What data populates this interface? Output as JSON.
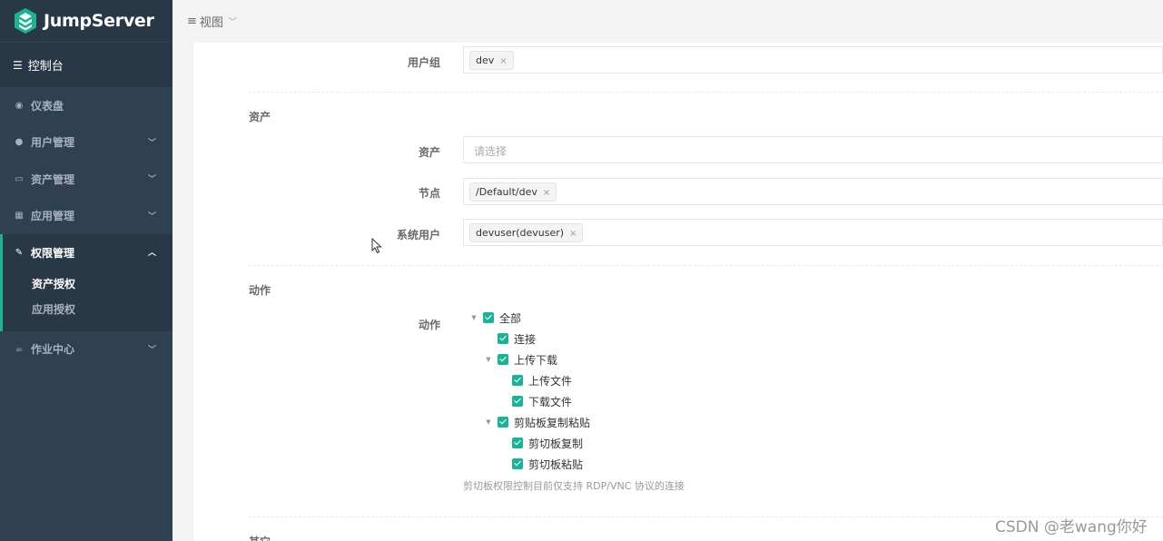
{
  "app": {
    "logo_text": "JumpServer"
  },
  "sidebar": {
    "console_label": "控制台",
    "items": [
      {
        "label": "仪表盘",
        "icon": "dashboard-icon",
        "expandable": false
      },
      {
        "label": "用户管理",
        "icon": "users-icon",
        "expandable": true
      },
      {
        "label": "资产管理",
        "icon": "inbox-icon",
        "expandable": true
      },
      {
        "label": "应用管理",
        "icon": "grid-icon",
        "expandable": true
      },
      {
        "label": "权限管理",
        "icon": "edit-icon",
        "expandable": true,
        "expanded": true
      },
      {
        "label": "作业中心",
        "icon": "coffee-icon",
        "expandable": true
      }
    ],
    "submenu": [
      {
        "label": "资产授权",
        "active": true
      },
      {
        "label": "应用授权",
        "active": false
      }
    ]
  },
  "topbar": {
    "view_label": "视图"
  },
  "form": {
    "user_group": {
      "label": "用户组",
      "tag": "dev"
    },
    "assets_section": "资产",
    "asset": {
      "label": "资产",
      "placeholder": "请选择"
    },
    "node": {
      "label": "节点",
      "tag": "/Default/dev"
    },
    "system_user": {
      "label": "系统用户",
      "tag": "devuser(devuser)"
    },
    "actions_section": "动作",
    "actions": {
      "label": "动作",
      "tree": [
        {
          "label": "全部",
          "level": 0,
          "has_children": true,
          "checked": true
        },
        {
          "label": "连接",
          "level": 1,
          "has_children": false,
          "checked": true
        },
        {
          "label": "上传下载",
          "level": 1,
          "has_children": true,
          "checked": true
        },
        {
          "label": "上传文件",
          "level": 2,
          "has_children": false,
          "checked": true
        },
        {
          "label": "下载文件",
          "level": 2,
          "has_children": false,
          "checked": true
        },
        {
          "label": "剪贴板复制粘贴",
          "level": 1,
          "has_children": true,
          "checked": true
        },
        {
          "label": "剪切板复制",
          "level": 2,
          "has_children": false,
          "checked": true
        },
        {
          "label": "剪切板粘贴",
          "level": 2,
          "has_children": false,
          "checked": true
        }
      ],
      "help": "剪切板权限控制目前仅支持 RDP/VNC 协议的连接"
    },
    "other_section": "其它"
  },
  "watermark": "CSDN @老wang你好",
  "colors": {
    "sidebar_bg": "#2f4050",
    "sidebar_active_bg": "#293846",
    "accent": "#1ab394"
  }
}
